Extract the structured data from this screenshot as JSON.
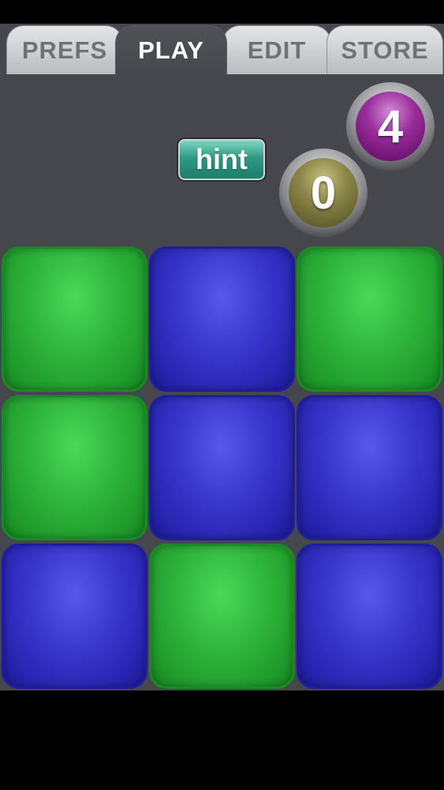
{
  "tabs": [
    {
      "label": "PREFS",
      "active": false
    },
    {
      "label": "PLAY",
      "active": true
    },
    {
      "label": "EDIT",
      "active": false
    },
    {
      "label": "STORE",
      "active": false
    }
  ],
  "hint": {
    "label": "hint",
    "color": "#2f9a83"
  },
  "counters": {
    "top": {
      "value": "4",
      "color": "#9a2e9c"
    },
    "bottom": {
      "value": "0",
      "color": "#8b8648"
    }
  },
  "grid": {
    "rows": 3,
    "cols": 3,
    "cells": [
      [
        "green",
        "blue",
        "green"
      ],
      [
        "green",
        "blue",
        "blue"
      ],
      [
        "blue",
        "green",
        "blue"
      ]
    ],
    "colors": {
      "green": "#2fb53c",
      "blue": "#3936cc"
    }
  }
}
